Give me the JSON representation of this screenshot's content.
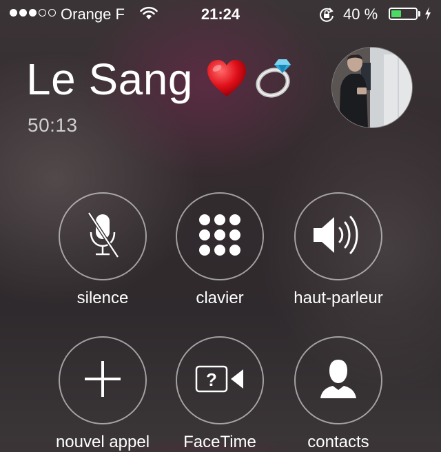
{
  "status_bar": {
    "carrier": "Orange F",
    "signal_bars_filled": 3,
    "signal_bars_total": 5,
    "time": "21:24",
    "battery_text": "40 %",
    "battery_level": 0.4,
    "battery_color": "#4cd964",
    "icons": [
      "wifi-icon",
      "orientation-lock-icon",
      "battery-icon",
      "charging-bolt-icon"
    ]
  },
  "call": {
    "caller_name": "Le Sang",
    "caller_emojis": [
      "heart-emoji",
      "ring-emoji"
    ],
    "duration": "50:13"
  },
  "controls": {
    "row1": [
      {
        "label": "silence",
        "icon": "microphone-muted-icon"
      },
      {
        "label": "clavier",
        "icon": "keypad-icon"
      },
      {
        "label": "haut-parleur",
        "icon": "speaker-icon"
      }
    ],
    "row2": [
      {
        "label": "nouvel appel",
        "icon": "plus-icon"
      },
      {
        "label": "FaceTime",
        "icon": "facetime-icon"
      },
      {
        "label": "contacts",
        "icon": "contact-icon"
      }
    ]
  }
}
